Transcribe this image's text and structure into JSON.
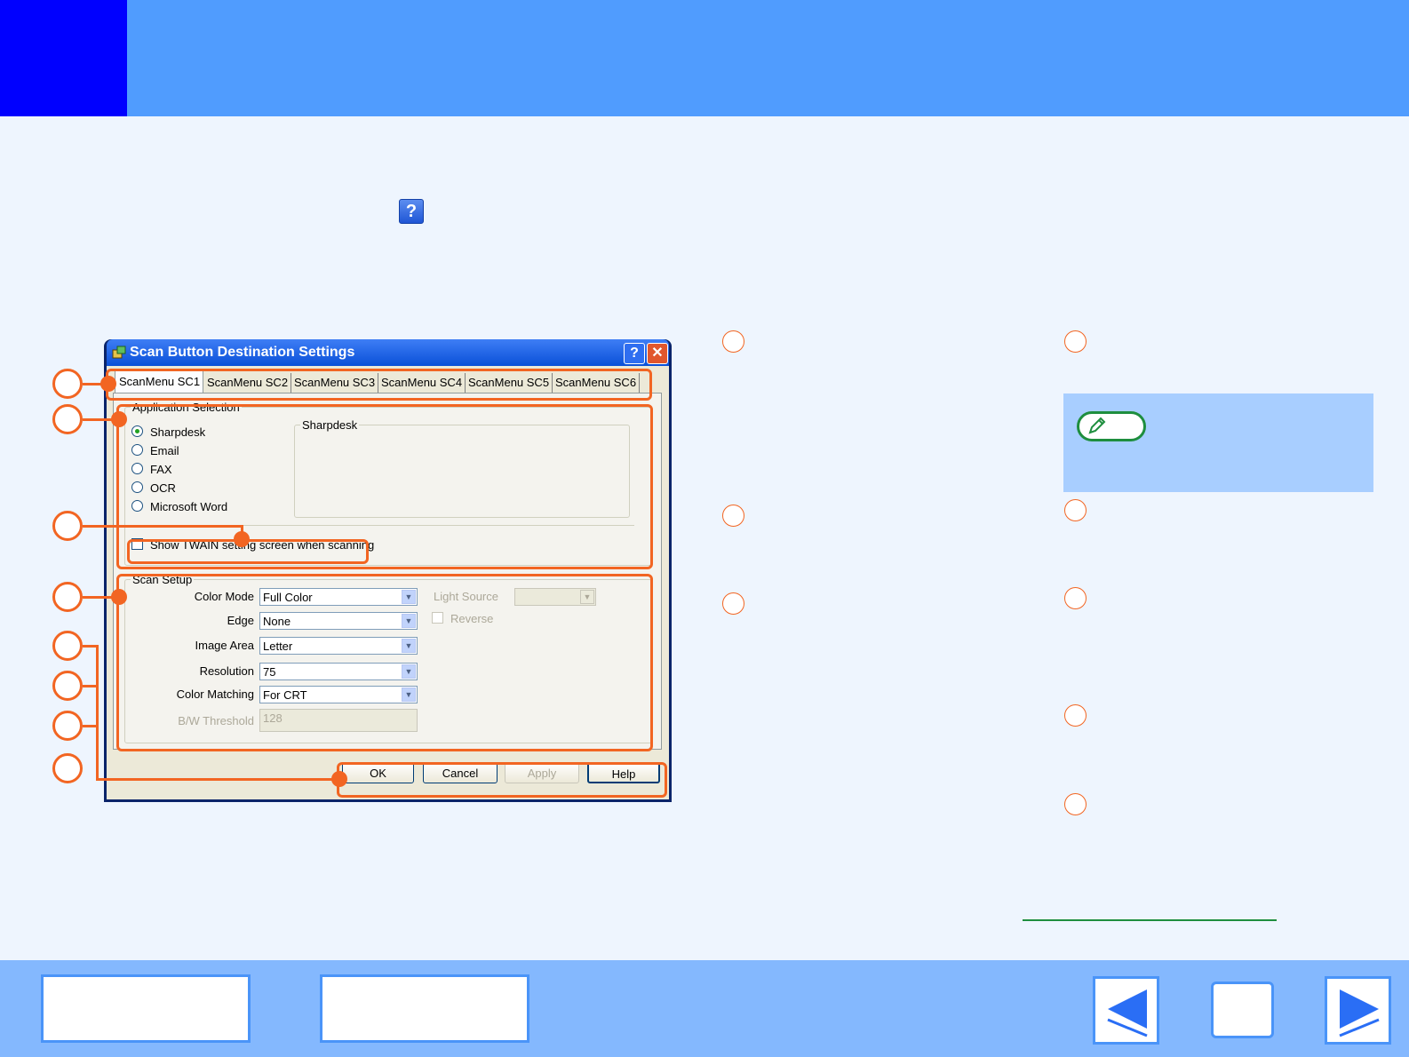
{
  "dialog": {
    "title": "Scan Button Destination Settings",
    "help_glyph": "?",
    "close_glyph": "✕",
    "tabs": [
      "ScanMenu SC1",
      "ScanMenu SC2",
      "ScanMenu SC3",
      "ScanMenu SC4",
      "ScanMenu SC5",
      "ScanMenu SC6"
    ],
    "active_tab": "ScanMenu SC1",
    "app_selection": {
      "legend": "Application Selection",
      "options": [
        "Sharpdesk",
        "Email",
        "FAX",
        "OCR",
        "Microsoft Word"
      ],
      "selected": "Sharpdesk",
      "preview_legend": "Sharpdesk",
      "twain_checkbox": "Show TWAIN setting screen when scanning"
    },
    "scan_setup": {
      "legend": "Scan Setup",
      "color_mode_label": "Color Mode",
      "color_mode_value": "Full Color",
      "edge_label": "Edge",
      "edge_value": "None",
      "image_area_label": "Image Area",
      "image_area_value": "Letter",
      "resolution_label": "Resolution",
      "resolution_value": "75",
      "color_matching_label": "Color Matching",
      "color_matching_value": "For CRT",
      "bw_threshold_label": "B/W Threshold",
      "bw_threshold_value": "128",
      "light_source_label": "Light Source",
      "reverse_label": "Reverse"
    },
    "buttons": {
      "ok": "OK",
      "cancel": "Cancel",
      "apply": "Apply",
      "help": "Help"
    }
  },
  "help_badge": "?",
  "colors": {
    "header_blue": "#509cfe",
    "header_block": "#0000ff",
    "callout_orange": "#f26522",
    "note_green": "#1e8e3e",
    "note_bg": "#a8ceff",
    "footer_blue": "#84b8fe"
  },
  "icons": [
    "help-icon",
    "pencil-icon",
    "back-arrow-icon",
    "forward-arrow-icon"
  ]
}
